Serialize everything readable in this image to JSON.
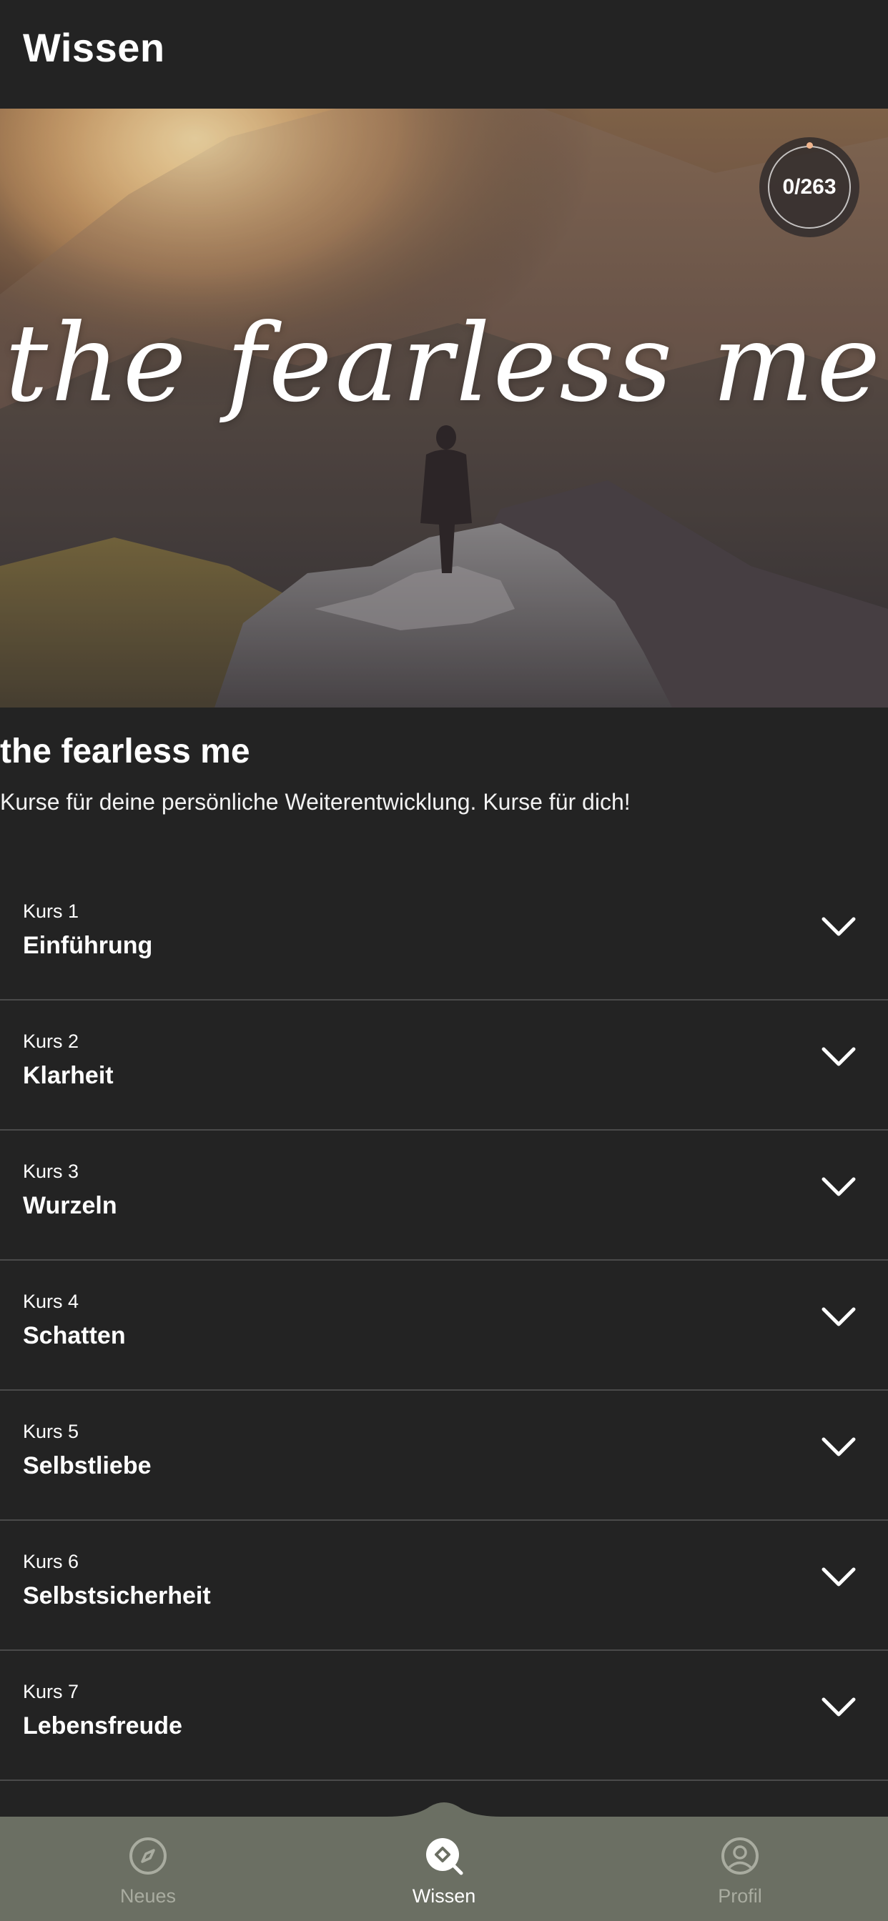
{
  "header": {
    "title": "Wissen"
  },
  "hero": {
    "script_title": "the fearless me",
    "progress": "0/263"
  },
  "course": {
    "title": "the fearless me",
    "subtitle": "Kurse für deine persönliche Weiterentwicklung. Kurse für dich!"
  },
  "kurse": [
    {
      "number": "Kurs 1",
      "name": "Einführung"
    },
    {
      "number": "Kurs 2",
      "name": "Klarheit"
    },
    {
      "number": "Kurs 3",
      "name": "Wurzeln"
    },
    {
      "number": "Kurs 4",
      "name": "Schatten"
    },
    {
      "number": "Kurs 5",
      "name": "Selbstliebe"
    },
    {
      "number": "Kurs 6",
      "name": "Selbstsicherheit"
    },
    {
      "number": "Kurs 7",
      "name": "Lebensfreude"
    }
  ],
  "bottom_nav": {
    "items": [
      {
        "label": "Neues",
        "icon": "compass-icon",
        "active": false
      },
      {
        "label": "Wissen",
        "icon": "knowledge-search-icon",
        "active": true
      },
      {
        "label": "Profil",
        "icon": "profile-icon",
        "active": false
      }
    ]
  },
  "colors": {
    "background": "#232323",
    "nav_background": "#6b6f63",
    "nav_inactive": "#a9aca0",
    "progress_accent": "#f1b58d"
  }
}
